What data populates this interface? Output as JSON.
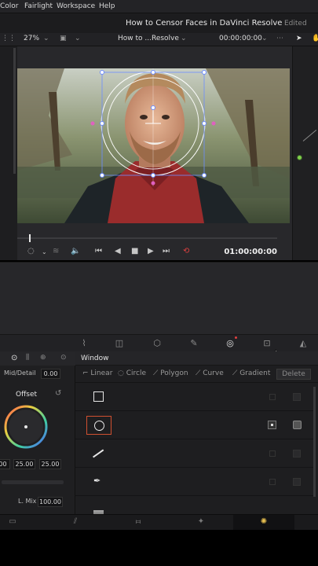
{
  "menu": {
    "items": [
      "Color",
      "Fairlight",
      "Workspace",
      "Help"
    ]
  },
  "title": {
    "project": "How to Censor Faces in DaVinci Resolve",
    "status": "Edited"
  },
  "viewer": {
    "zoom": "27%",
    "clip_name": "How to ...Resolve",
    "header_timecode": "00:00:00:00",
    "timecode": "01:00:00:00"
  },
  "color_panel": {
    "mid_detail_label": "Mid/Detail",
    "mid_detail_value": "0.00",
    "wheel_label": "Offset",
    "offset_values": [
      "00",
      "25.00",
      "25.00"
    ],
    "lum_mix_label": "L. Mix",
    "lum_mix_value": "100.00"
  },
  "window_panel": {
    "title": "Window",
    "types": [
      "Linear",
      "Circle",
      "Polygon",
      "Curve",
      "Gradient"
    ],
    "delete_label": "Delete",
    "shapes": [
      "square-icon",
      "circle-icon",
      "line-icon",
      "pen-icon",
      "gradient-icon"
    ]
  },
  "colors": {
    "accent_red": "#d05030",
    "selection_blue": "#6c8cff",
    "node_green": "#7fd04a"
  }
}
